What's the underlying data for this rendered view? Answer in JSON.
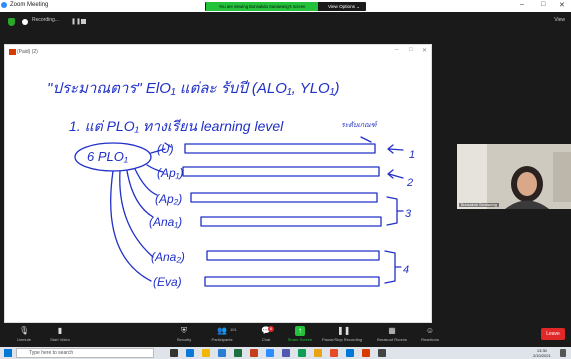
{
  "window": {
    "title": "Zoom Meeting",
    "controls": [
      "–",
      "□",
      "✕"
    ]
  },
  "banner": {
    "message": "You are viewing Bunsakda Saraiwong's screen",
    "options": "View Options ⌄"
  },
  "topbar": {
    "recording": "Recording...",
    "view": "View"
  },
  "whiteboard": {
    "title": "(Paid) (2)",
    "controls": [
      "–",
      "□",
      "✕"
    ]
  },
  "handwriting": {
    "line1": "\"ประมาณตาร\" ElO₁ แต่ละ รับปี (ALO₁, YLO₁)",
    "line2": "1. แต่ PLO₁ ทางเรียน learning level",
    "note_top": "ระดับเกณฑ์",
    "plos": "6 PLO₁",
    "levels": [
      "(U)",
      "(Ap₁)",
      "(Ap₂)",
      "(Ana₁)",
      "(Ana₂)",
      "(Eva)"
    ],
    "arrows": [
      "1",
      "2",
      "3",
      "4"
    ]
  },
  "camera": {
    "name": "Bunsakda Saraiwong"
  },
  "controls": [
    {
      "label": "Unmute",
      "icon": "microphone-icon"
    },
    {
      "label": "Start Video",
      "icon": "video-icon"
    },
    {
      "label": "Security",
      "icon": "shield-icon"
    },
    {
      "label": "Participants",
      "icon": "participants-icon",
      "count": "101"
    },
    {
      "label": "Chat",
      "icon": "chat-icon",
      "badge": "6"
    },
    {
      "label": "Share Screen",
      "icon": "share-icon"
    },
    {
      "label": "Pause/Stop Recording",
      "icon": "record-icon"
    },
    {
      "label": "Breakout Rooms",
      "icon": "grid-icon"
    },
    {
      "label": "Reactions",
      "icon": "smile-icon"
    }
  ],
  "leave": "Leave",
  "taskbar": {
    "search": "Type here to search",
    "time": "13:30",
    "date": "2/10/2021"
  },
  "colors": {
    "share": "#23c23a",
    "leave": "#e02828",
    "ink": "#2030c8",
    "record": "#e02828"
  }
}
